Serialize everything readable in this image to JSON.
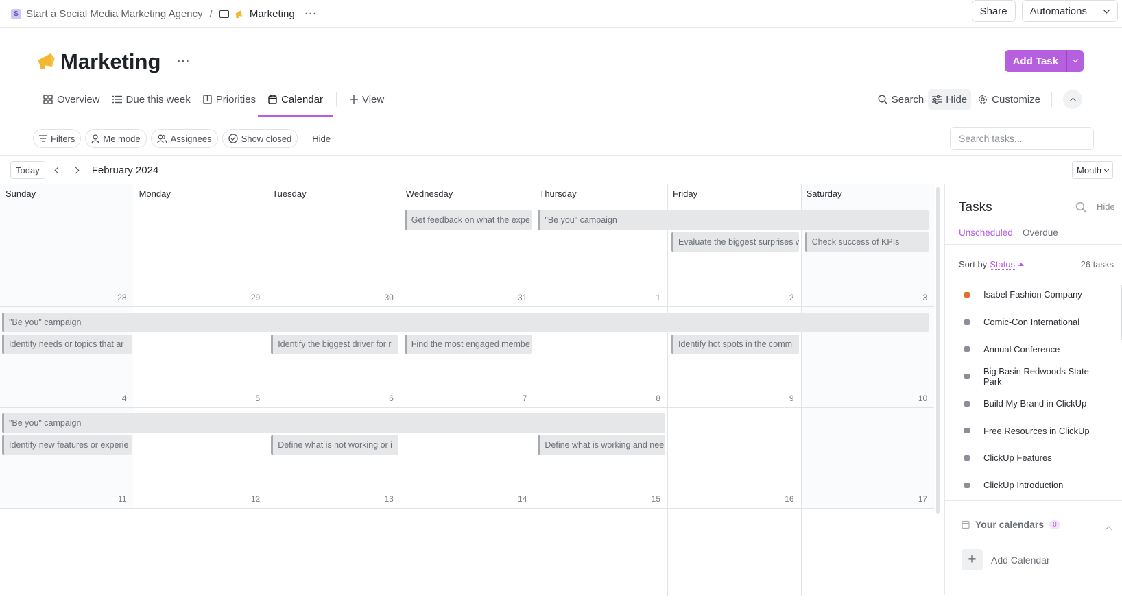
{
  "breadcrumb": {
    "workspace_initial": "S",
    "workspace": "Start a Social Media Marketing Agency",
    "separator": "/",
    "current": "Marketing",
    "more": "···"
  },
  "top_actions": {
    "share": "Share",
    "automations": "Automations"
  },
  "page": {
    "title": "Marketing",
    "more": "···",
    "add_task": "Add Task"
  },
  "tabs": [
    {
      "label": "Overview",
      "icon": "overview-icon"
    },
    {
      "label": "Due this week",
      "icon": "list-icon"
    },
    {
      "label": "Priorities",
      "icon": "board-icon"
    },
    {
      "label": "Calendar",
      "icon": "calendar-icon",
      "active": true
    },
    {
      "label": "View",
      "icon": "plus-icon"
    }
  ],
  "view_actions": {
    "search": "Search",
    "hide": "Hide",
    "customize": "Customize"
  },
  "filters": {
    "filters": "Filters",
    "me_mode": "Me mode",
    "assignees": "Assignees",
    "show_closed": "Show closed",
    "hide": "Hide",
    "search_placeholder": "Search tasks..."
  },
  "calendar": {
    "today": "Today",
    "month_label": "February 2024",
    "view_mode": "Month",
    "weekdays": [
      "Sunday",
      "Monday",
      "Tuesday",
      "Wednesday",
      "Thursday",
      "Friday",
      "Saturday"
    ],
    "weeks": [
      [
        "28",
        "29",
        "30",
        "31",
        "1",
        "2",
        "3"
      ],
      [
        "4",
        "5",
        "6",
        "7",
        "8",
        "9",
        "10"
      ],
      [
        "11",
        "12",
        "13",
        "14",
        "15",
        "16",
        "17"
      ],
      [
        "",
        "",
        "",
        "",
        "",
        "",
        ""
      ]
    ],
    "events": [
      {
        "title": "Get feedback on what the expe",
        "week": 0,
        "start": 3,
        "span": 1,
        "lane": 0
      },
      {
        "title": "\"Be you\" campaign",
        "week": 0,
        "start": 4,
        "span": 3,
        "lane": 0
      },
      {
        "title": "Evaluate the biggest surprises w",
        "week": 0,
        "start": 5,
        "span": 1,
        "lane": 1
      },
      {
        "title": "Check success of KPIs",
        "week": 0,
        "start": 6,
        "span": 1,
        "lane": 1
      },
      {
        "title": "\"Be you\" campaign",
        "week": 1,
        "start": 0,
        "span": 7,
        "lane": 0
      },
      {
        "title": "Identify needs or topics that ar",
        "week": 1,
        "start": 0,
        "span": 1,
        "lane": 1
      },
      {
        "title": "Identify the biggest driver for r",
        "week": 1,
        "start": 2,
        "span": 1,
        "lane": 1
      },
      {
        "title": "Find the most engaged membe",
        "week": 1,
        "start": 3,
        "span": 1,
        "lane": 1
      },
      {
        "title": "Identify hot spots in the comm",
        "week": 1,
        "start": 5,
        "span": 1,
        "lane": 1
      },
      {
        "title": "\"Be you\" campaign",
        "week": 2,
        "start": 0,
        "span": 5,
        "lane": 0
      },
      {
        "title": "Identify new features or experie",
        "week": 2,
        "start": 0,
        "span": 1,
        "lane": 1
      },
      {
        "title": "Define what is not working or i",
        "week": 2,
        "start": 2,
        "span": 1,
        "lane": 1
      },
      {
        "title": "Define what is working and nee",
        "week": 2,
        "start": 4,
        "span": 1,
        "lane": 1
      }
    ]
  },
  "sidebar": {
    "title": "Tasks",
    "hide": "Hide",
    "tabs": [
      "Unscheduled",
      "Overdue"
    ],
    "sort_by": "Sort by",
    "sort_field": "Status",
    "task_count": "26 tasks",
    "tasks": [
      {
        "name": "Isabel Fashion Company",
        "color": "#e0702c"
      },
      {
        "name": "Comic-Con International",
        "color": "#8a8f98"
      },
      {
        "name": "Annual Conference",
        "color": "#8a8f98"
      },
      {
        "name": "Big Basin Redwoods State Park",
        "color": "#8a8f98"
      },
      {
        "name": "Build My Brand in ClickUp",
        "color": "#8a8f98"
      },
      {
        "name": "Free Resources in ClickUp",
        "color": "#8a8f98"
      },
      {
        "name": "ClickUp Features",
        "color": "#8a8f98"
      },
      {
        "name": "ClickUp Introduction",
        "color": "#8a8f98"
      }
    ],
    "your_calendars": "Your calendars",
    "calendars_count": "0",
    "add_calendar": "Add Calendar"
  },
  "colors": {
    "accent": "#b660e0",
    "event_bg": "#e6e7e9",
    "event_border": "#a7aab0"
  }
}
